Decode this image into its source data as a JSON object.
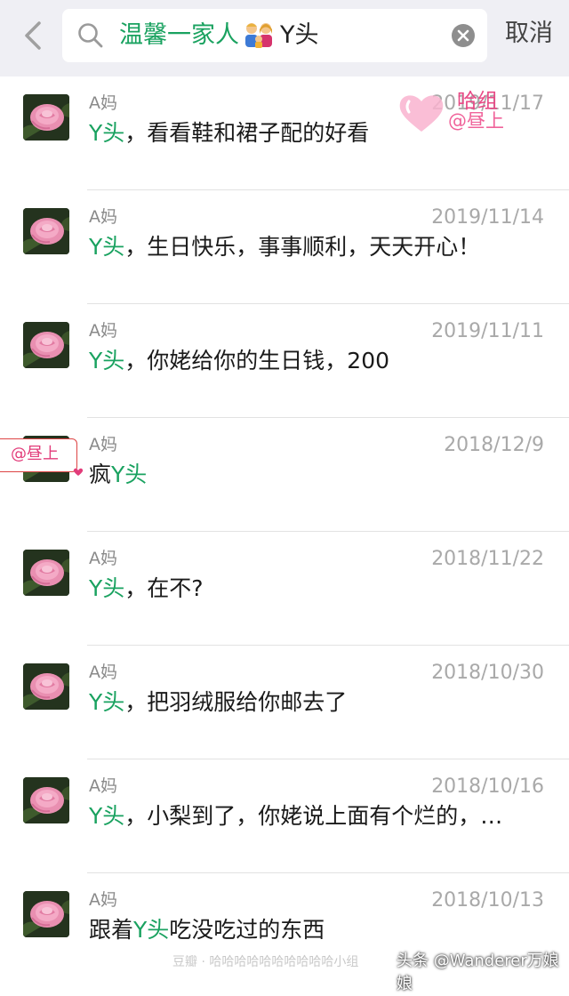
{
  "search": {
    "group_name": "温馨一家人",
    "keyword": "Y头",
    "cancel_label": "取消"
  },
  "results": [
    {
      "sender": "A妈",
      "date": "2019/11/17",
      "parts": [
        {
          "t": "Y头",
          "hl": true
        },
        {
          "t": "，看看鞋和裙子配的好看",
          "hl": false
        }
      ]
    },
    {
      "sender": "A妈",
      "date": "2019/11/14",
      "parts": [
        {
          "t": "Y头",
          "hl": true
        },
        {
          "t": "，生日快乐，事事顺利，天天开心！",
          "hl": false
        }
      ]
    },
    {
      "sender": "A妈",
      "date": "2019/11/11",
      "parts": [
        {
          "t": "Y头",
          "hl": true
        },
        {
          "t": "，你姥给你的生日钱，200",
          "hl": false
        }
      ]
    },
    {
      "sender": "A妈",
      "date": "2018/12/9",
      "parts": [
        {
          "t": "疯",
          "hl": false
        },
        {
          "t": "Y头",
          "hl": true
        }
      ]
    },
    {
      "sender": "A妈",
      "date": "2018/11/22",
      "parts": [
        {
          "t": "Y头",
          "hl": true
        },
        {
          "t": "，在不?",
          "hl": false
        }
      ]
    },
    {
      "sender": "A妈",
      "date": "2018/10/30",
      "parts": [
        {
          "t": "Y头",
          "hl": true
        },
        {
          "t": "，把羽绒服给你邮去了",
          "hl": false
        }
      ]
    },
    {
      "sender": "A妈",
      "date": "2018/10/16",
      "parts": [
        {
          "t": "Y头",
          "hl": true
        },
        {
          "t": "，小梨到了，你姥说上面有个烂的，…",
          "hl": false
        }
      ]
    },
    {
      "sender": "A妈",
      "date": "2018/10/13",
      "parts": [
        {
          "t": "跟着",
          "hl": false
        },
        {
          "t": "Y头",
          "hl": true
        },
        {
          "t": "吃没吃过的东西",
          "hl": false
        }
      ]
    }
  ],
  "stickers": {
    "top_line1": "哈组",
    "top_line2": "@昼上",
    "side_tag": "@昼上"
  },
  "footer": {
    "watermark": "豆瓣 · 哈哈哈哈哈哈哈哈哈哈小组",
    "credit": "头条 @Wanderer万娘娘"
  },
  "colors": {
    "highlight": "#1aa260",
    "topbar_bg": "#efeff4"
  },
  "icons": [
    "back-chevron-icon",
    "search-icon",
    "family-emoji-icon",
    "clear-icon",
    "rose-avatar-icon",
    "heart-sticker-icon"
  ]
}
